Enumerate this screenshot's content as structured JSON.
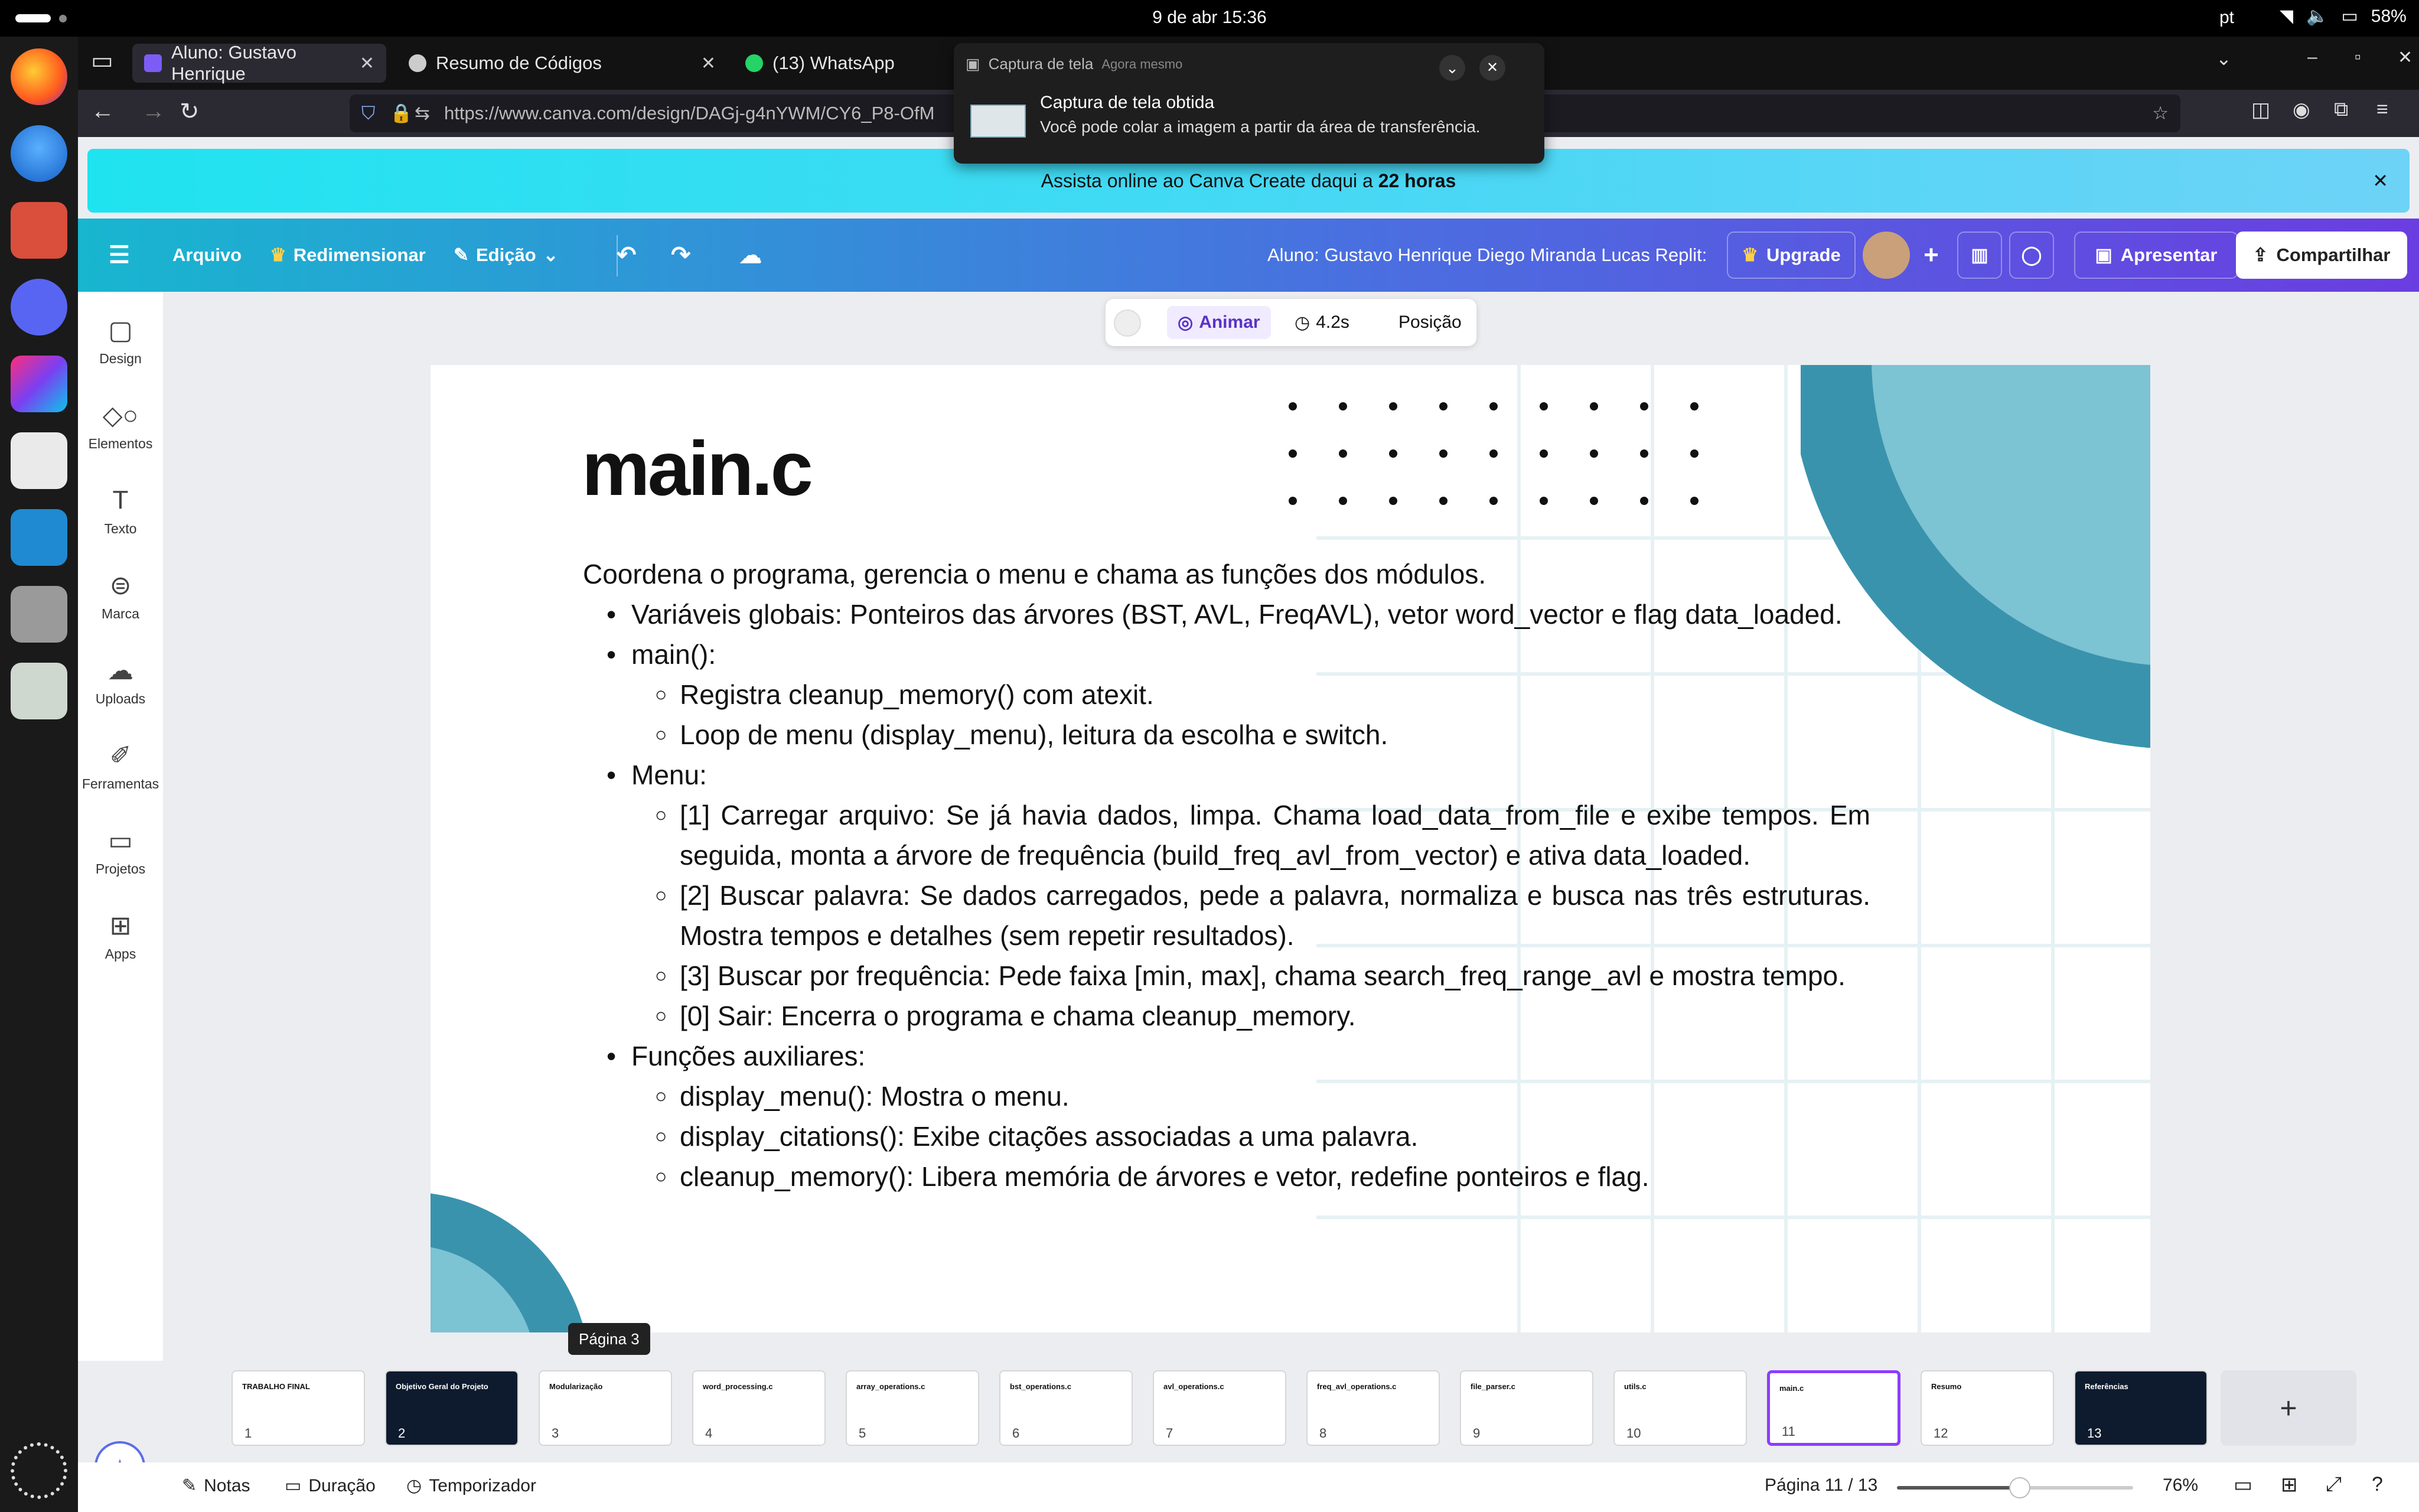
{
  "system": {
    "date_time": "9 de abr  15:36",
    "lang": "pt",
    "battery": "58%"
  },
  "tabs": [
    {
      "label": "Aluno: Gustavo Henrique"
    },
    {
      "label": "Resumo de Códigos"
    },
    {
      "label": "(13) WhatsApp"
    }
  ],
  "address": {
    "url": "https://www.canva.com/design/DAGj-g4nYWM/CY6_P8-OfM"
  },
  "notification": {
    "app": "Captura de tela",
    "when": "Agora mesmo",
    "title": "Captura de tela obtida",
    "body": "Você pode colar a imagem a partir da área de transferência."
  },
  "banner": {
    "text_pre": "Assista online ao Canva Create daqui a ",
    "text_bold": "22 horas"
  },
  "header": {
    "file": "Arquivo",
    "resize": "Redimensionar",
    "edit": "Edição",
    "doc_title": "Aluno: Gustavo Henrique Diego Miranda Lucas Replit:",
    "upgrade": "Upgrade",
    "present": "Apresentar",
    "share": "Compartilhar"
  },
  "sidebar": {
    "items": [
      {
        "label": "Design"
      },
      {
        "label": "Elementos"
      },
      {
        "label": "Texto"
      },
      {
        "label": "Marca"
      },
      {
        "label": "Uploads"
      },
      {
        "label": "Ferramentas"
      },
      {
        "label": "Projetos"
      },
      {
        "label": "Apps"
      }
    ]
  },
  "floating": {
    "animate": "Animar",
    "duration": "4.2s",
    "position": "Posição"
  },
  "slide": {
    "title": "main.c",
    "intro": "Coordena o programa, gerencia o menu e chama as funções dos módulos.",
    "items": [
      {
        "level": 1,
        "text": "Variáveis globais: Ponteiros das árvores (BST, AVL, FreqAVL), vetor word_vector e flag data_loaded."
      },
      {
        "level": 1,
        "text": "main():"
      },
      {
        "level": 2,
        "text": "Registra cleanup_memory() com atexit."
      },
      {
        "level": 2,
        "text": "Loop de menu (display_menu), leitura da escolha e switch."
      },
      {
        "level": 1,
        "text": "Menu:"
      },
      {
        "level": 2,
        "text": "[1] Carregar arquivo: Se já havia dados, limpa. Chama load_data_from_file e exibe tempos. Em seguida, monta a árvore de frequência (build_freq_avl_from_vector) e ativa data_loaded."
      },
      {
        "level": 2,
        "text": "[2] Buscar palavra: Se dados carregados, pede a palavra, normaliza e busca nas três estruturas. Mostra tempos e detalhes (sem repetir resultados)."
      },
      {
        "level": 2,
        "text": "[3] Buscar por frequência: Pede faixa [min, max], chama search_freq_range_avl e mostra tempo."
      },
      {
        "level": 2,
        "text": "[0] Sair: Encerra o programa e chama cleanup_memory."
      },
      {
        "level": 1,
        "text": "Funções auxiliares:"
      },
      {
        "level": 2,
        "text": "display_menu(): Mostra o menu."
      },
      {
        "level": 2,
        "text": "display_citations(): Exibe citações associadas a uma palavra."
      },
      {
        "level": 2,
        "text": "cleanup_memory(): Libera memória de árvores e vetor, redefine ponteiros e flag."
      }
    ]
  },
  "tooltip": "Página 3",
  "thumbnails": [
    {
      "n": "1",
      "title": "TRABALHO FINAL"
    },
    {
      "n": "2",
      "title": "Objetivo Geral do Projeto",
      "dark": true
    },
    {
      "n": "3",
      "title": "Modularização"
    },
    {
      "n": "4",
      "title": "word_processing.c"
    },
    {
      "n": "5",
      "title": "array_operations.c"
    },
    {
      "n": "6",
      "title": "bst_operations.c"
    },
    {
      "n": "7",
      "title": "avl_operations.c"
    },
    {
      "n": "8",
      "title": "freq_avl_operations.c"
    },
    {
      "n": "9",
      "title": "file_parser.c"
    },
    {
      "n": "10",
      "title": "utils.c"
    },
    {
      "n": "11",
      "title": "main.c",
      "selected": true
    },
    {
      "n": "12",
      "title": "Resumo"
    },
    {
      "n": "13",
      "title": "Referências",
      "dark": true
    }
  ],
  "bottom": {
    "notes": "Notas",
    "duration": "Duração",
    "timer": "Temporizador",
    "page": "Página 11 / 13",
    "zoom": "76%",
    "zoom_level": 0.52
  },
  "colors": {
    "canva_purple": "#8b3dff",
    "teal": "#3a93ad",
    "light_teal": "#7cc3d3"
  }
}
